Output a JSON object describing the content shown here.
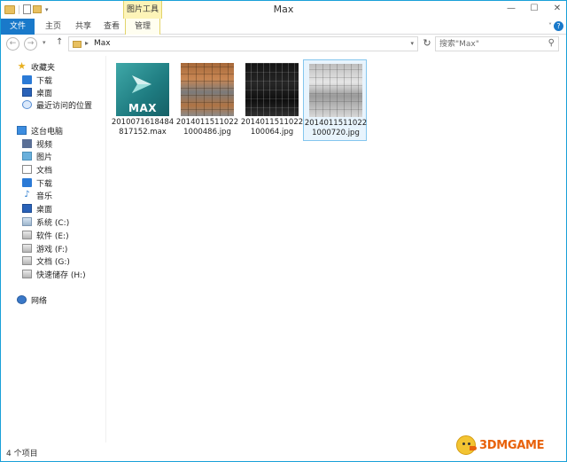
{
  "window": {
    "title": "Max",
    "controls": {
      "minimize": "—",
      "maximize": "☐",
      "close": "✕"
    }
  },
  "ribbon": {
    "context_tab_header": "图片工具",
    "tabs": [
      {
        "label": "文件",
        "active": true
      },
      {
        "label": "主页"
      },
      {
        "label": "共享"
      },
      {
        "label": "查看"
      },
      {
        "label": "管理"
      }
    ],
    "toggle": "˅",
    "help": "?"
  },
  "address_bar": {
    "path": "Max",
    "separator": "▸",
    "search_placeholder": "搜索\"Max\""
  },
  "navigation_pane": {
    "favorites": {
      "label": "收藏夹",
      "items": [
        "下载",
        "桌面",
        "最近访问的位置"
      ]
    },
    "this_pc": {
      "label": "这台电脑",
      "items": [
        "视频",
        "图片",
        "文档",
        "下载",
        "音乐",
        "桌面",
        "系统 (C:)",
        "软件 (E:)",
        "游戏 (F:)",
        "文档 (G:)",
        "快速储存 (H:)"
      ]
    },
    "network": {
      "label": "网络"
    }
  },
  "files": [
    {
      "name": "20100716184848 17152.max",
      "line1": "2010071618484",
      "line2": "817152.max",
      "thumb_text": "MAX"
    },
    {
      "name": "2014011511022 1000486.jpg",
      "line1": "2014011511022",
      "line2": "1000486.jpg"
    },
    {
      "name": "2014011511022 100064.jpg",
      "line1": "2014011511022",
      "line2": "100064.jpg"
    },
    {
      "name": "2014011511022 1000720.jpg",
      "line1": "2014011511022",
      "line2": "1000720.jpg",
      "selected": true
    }
  ],
  "status": {
    "item_count": "4 个项目"
  },
  "watermark": {
    "text": "3DMGAME"
  },
  "colors": {
    "accent": "#1979ca",
    "window_border": "#19a0d8",
    "context_tab": "#fdf4b8",
    "selection": "#e8f4fd",
    "selection_border": "#84c6ee"
  }
}
